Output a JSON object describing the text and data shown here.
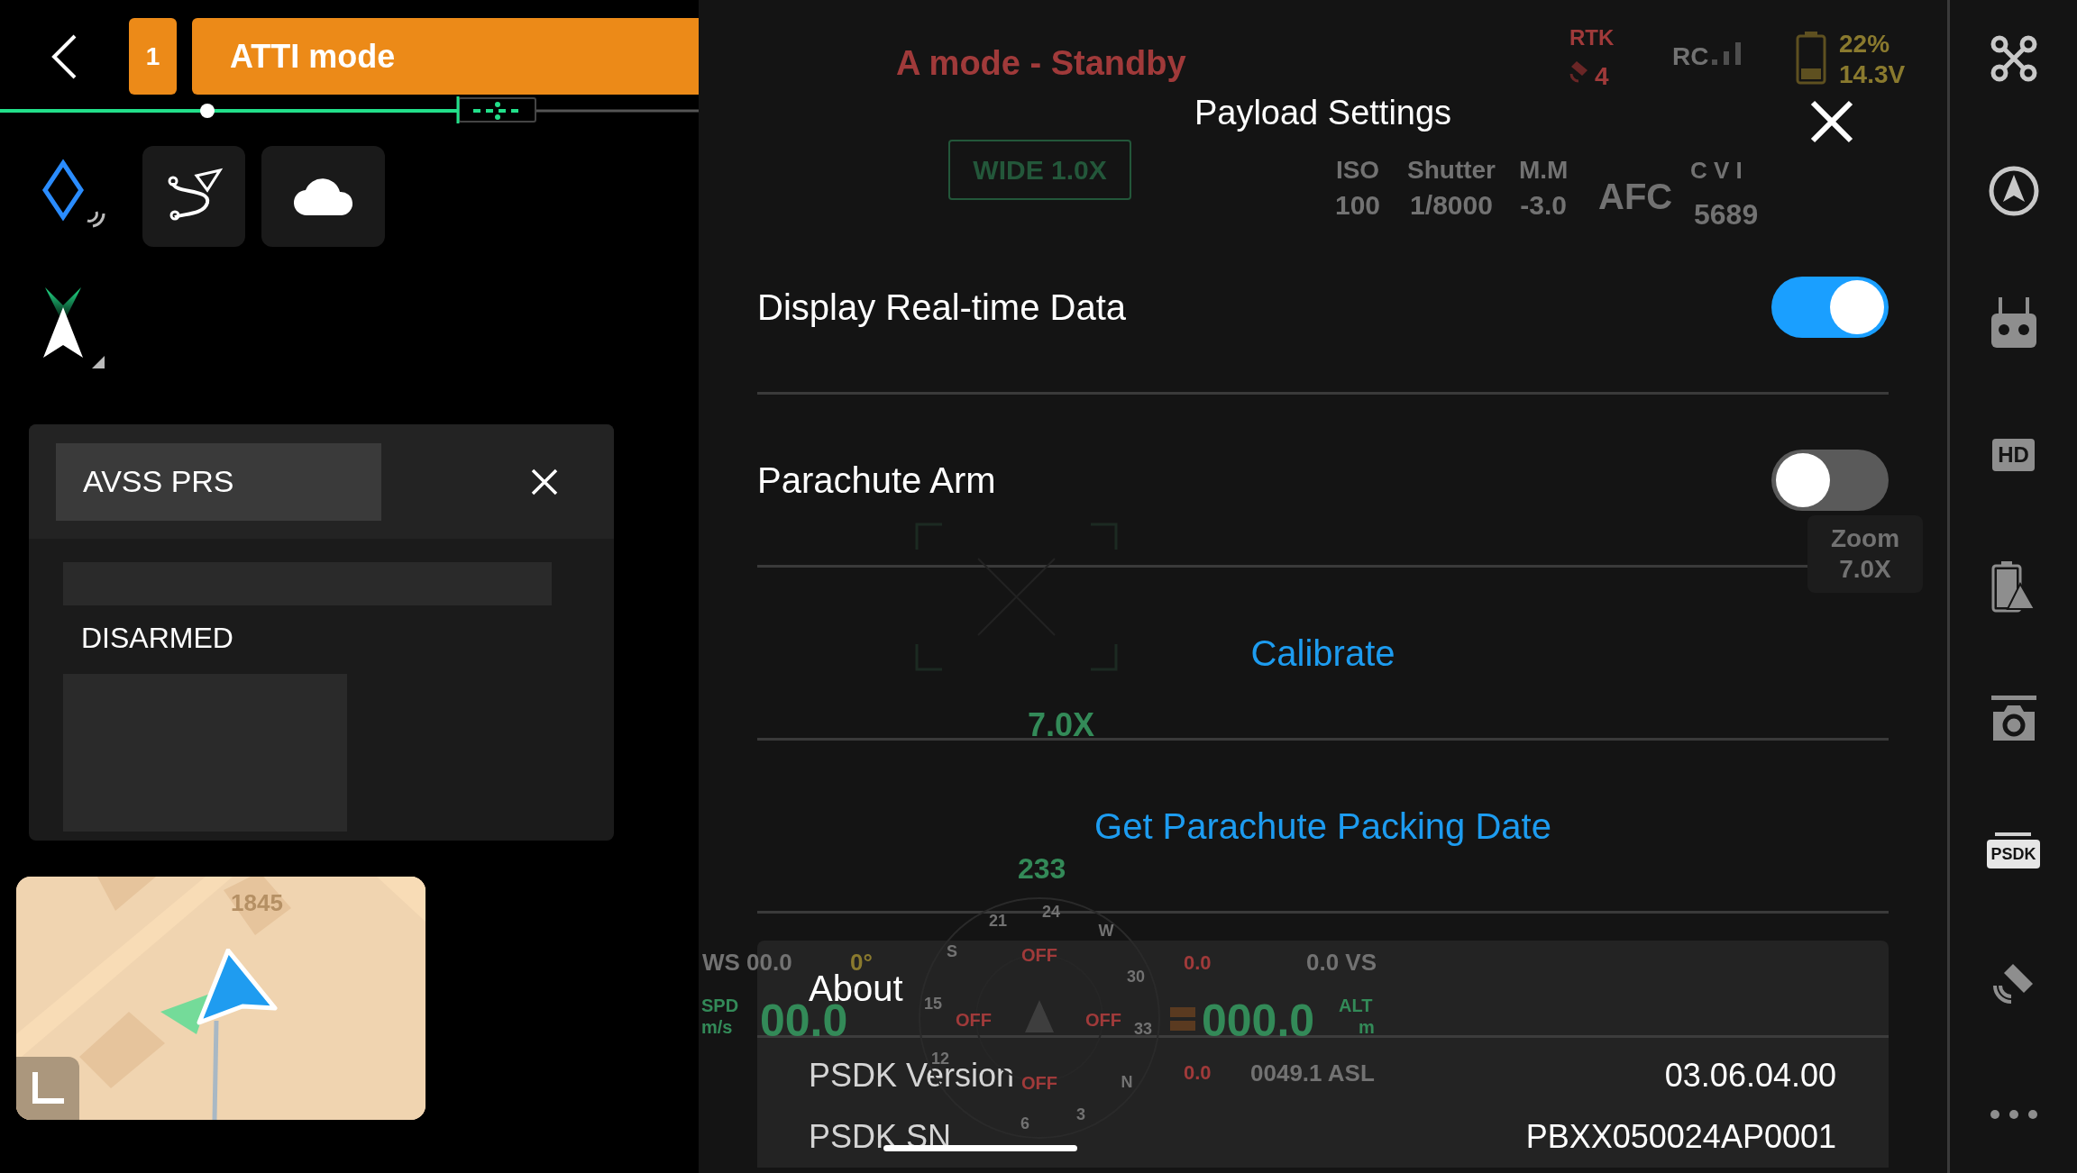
{
  "top_bar": {
    "mode_number": "1",
    "flight_mode": "ATTI mode"
  },
  "avss_panel": {
    "tag": "AVSS PRS",
    "status": "DISARMED"
  },
  "minimap": {
    "label": "1845"
  },
  "hud": {
    "status": "A mode - Standby",
    "rtk_label": "RTK",
    "rtk_count": "4",
    "rc_label": "RC",
    "battery_percent": "22%",
    "battery_voltage": "14.3V",
    "lens": "WIDE 1.0X",
    "exposure": [
      {
        "label": "ISO",
        "value": "100"
      },
      {
        "label": "Shutter",
        "value": "1/8000"
      },
      {
        "label": "M.M",
        "value": "-3.0"
      }
    ],
    "focus": "AFC",
    "storage_label": "C V I",
    "storage_value": "5689",
    "zoom": "7.0X",
    "zoom_box": {
      "label": "Zoom",
      "value": "7.0X"
    },
    "heading": "233",
    "compass_marks": [
      "24",
      "W",
      "30",
      "33",
      "N",
      "3",
      "6",
      "12",
      "15",
      "S",
      "21"
    ],
    "obstacle_labels": [
      "OFF",
      "OFF",
      "OFF",
      "OFF"
    ],
    "wind": "WS 00.0",
    "angle": "0°",
    "speed_label": "SPD",
    "speed_unit": "m/s",
    "speed": "00.0",
    "left_small": "0.0",
    "vertical_speed": "0.0 VS",
    "altitude": "000.0",
    "alt_label": "ALT",
    "alt_unit": "m",
    "bottom_small": "0.0",
    "asl": "0049.1 ASL"
  },
  "payload_settings": {
    "title": "Payload Settings",
    "settings": [
      {
        "kind": "toggle",
        "label": "Display Real-time Data",
        "on": true
      },
      {
        "kind": "toggle",
        "label": "Parachute Arm",
        "on": false
      },
      {
        "kind": "action",
        "label": "Calibrate"
      },
      {
        "kind": "action",
        "label": "Get Parachute Packing Date"
      }
    ],
    "about": {
      "title": "About",
      "rows": [
        {
          "label": "PSDK Version",
          "value": "03.06.04.00"
        },
        {
          "label": "PSDK SN",
          "value": "PBXX050024AP0001"
        }
      ]
    }
  },
  "sidebar": {
    "items": [
      {
        "kind": "drone"
      },
      {
        "kind": "flight"
      },
      {
        "kind": "remote"
      },
      {
        "kind": "badge",
        "label": "HD"
      },
      {
        "kind": "battery"
      },
      {
        "kind": "camera"
      },
      {
        "kind": "badge_bar",
        "label": "PSDK"
      },
      {
        "kind": "satellite"
      },
      {
        "kind": "more"
      }
    ]
  }
}
